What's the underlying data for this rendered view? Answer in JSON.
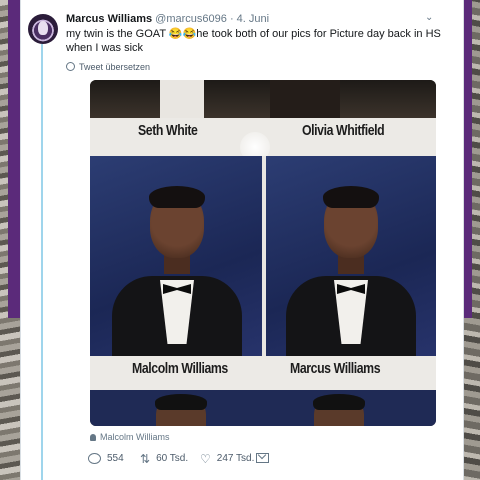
{
  "tweet": {
    "author_name": "Marcus Williams",
    "author_handle": "@marcus6096",
    "separator": "·",
    "date": "4. Juni",
    "text": "my twin is the GOAT 😂😂he took both of our pics for Picture day back in HS when I was sick",
    "translate_label": "Tweet übersetzen",
    "media_tag": "Malcolm Williams",
    "reply_count": "554",
    "retweet_count": "60 Tsd.",
    "like_count": "247 Tsd."
  },
  "yearbook": {
    "top_left_name": "Seth White",
    "top_right_name": "Olivia Whitfield",
    "bottom_left_name": "Malcolm Williams",
    "bottom_right_name": "Marcus Williams"
  },
  "icons": {
    "caret": "chevron-down-icon",
    "translate": "globe-icon",
    "tag": "person-icon",
    "reply": "reply-icon",
    "retweet": "retweet-icon",
    "like": "heart-icon",
    "dm": "envelope-icon"
  },
  "colors": {
    "accent_line": "#9fd5ec",
    "band": "#5b2a7a",
    "muted": "#657786"
  }
}
